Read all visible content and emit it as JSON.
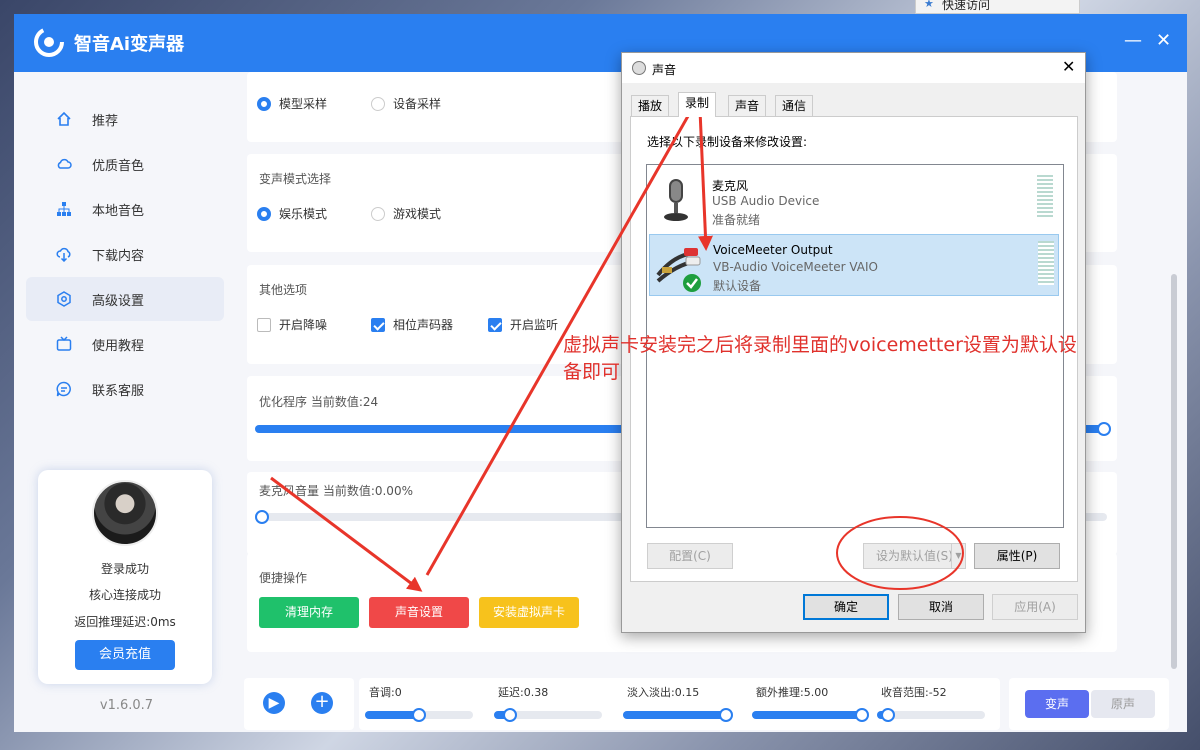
{
  "background_window": {
    "label": "快速访问"
  },
  "app": {
    "title": "智音Ai变声器",
    "minimize": "—",
    "close": "✕",
    "accent": "#2a7ff0"
  },
  "sidebar": {
    "items": [
      {
        "label": "推荐",
        "icon": "home-icon"
      },
      {
        "label": "优质音色",
        "icon": "cloud-icon"
      },
      {
        "label": "本地音色",
        "icon": "sitemap-icon"
      },
      {
        "label": "下载内容",
        "icon": "download-cloud-icon"
      },
      {
        "label": "高级设置",
        "icon": "settings-icon",
        "active": true
      },
      {
        "label": "使用教程",
        "icon": "tv-icon"
      },
      {
        "label": "联系客服",
        "icon": "chat-icon"
      }
    ]
  },
  "profile": {
    "login": "登录成功",
    "core": "核心连接成功",
    "latency": "返回推理延迟:0ms",
    "vip_button": "会员充值"
  },
  "version": "v1.6.0.7",
  "settings": {
    "sampling": {
      "options": [
        "模型采样",
        "设备采样"
      ],
      "selected": 0
    },
    "mode": {
      "title": "变声模式选择",
      "options": [
        "娱乐模式",
        "游戏模式"
      ],
      "selected": 0
    },
    "other": {
      "title": "其他选项",
      "options": [
        {
          "label": "开启降噪",
          "checked": false
        },
        {
          "label": "相位声码器",
          "checked": true
        },
        {
          "label": "开启监听",
          "checked": true
        }
      ]
    },
    "optimize": {
      "label": "优化程序 当前数值:24"
    },
    "mic_volume": {
      "label": "麦克风音量 当前数值:0.00%"
    },
    "quick": {
      "title": "便捷操作",
      "buttons": [
        {
          "label": "清理内存",
          "color": "#1fc16b"
        },
        {
          "label": "声音设置",
          "color": "#f04848"
        },
        {
          "label": "安装虚拟声卡",
          "color": "#f7c21c"
        }
      ]
    }
  },
  "bottom": {
    "play": "▶",
    "add": "+",
    "sliders": [
      {
        "label": "音调:0",
        "level": 0.5
      },
      {
        "label": "延迟:0.38",
        "level": 0.15
      },
      {
        "label": "淡入淡出:0.15",
        "level": 0.95
      },
      {
        "label": "额外推理:5.00",
        "level": 0.95
      },
      {
        "label": "收音范围:-52",
        "level": 0.1
      }
    ],
    "toggle": {
      "on": "变声",
      "off": "原声"
    }
  },
  "dialog": {
    "title": "声音",
    "close": "✕",
    "tabs": [
      "播放",
      "录制",
      "声音",
      "通信"
    ],
    "selected_tab": 1,
    "instruction": "选择以下录制设备来修改设置:",
    "devices": [
      {
        "name": "麦克风",
        "desc": "USB Audio Device",
        "status": "准备就绪",
        "icon": "microphone-icon",
        "selected": false
      },
      {
        "name": "VoiceMeeter Output",
        "desc": "VB-Audio VoiceMeeter VAIO",
        "status": "默认设备",
        "icon": "rca-cable-icon",
        "selected": true
      }
    ],
    "buttons": {
      "configure": "配置(C)",
      "set_default": "设为默认值(S)",
      "properties": "属性(P)",
      "ok": "确定",
      "cancel": "取消",
      "apply": "应用(A)"
    }
  },
  "annotation": {
    "text": "虚拟声卡安装完之后将录制里面的voicemetter设置为默认设备即可",
    "color": "#e0312c"
  }
}
